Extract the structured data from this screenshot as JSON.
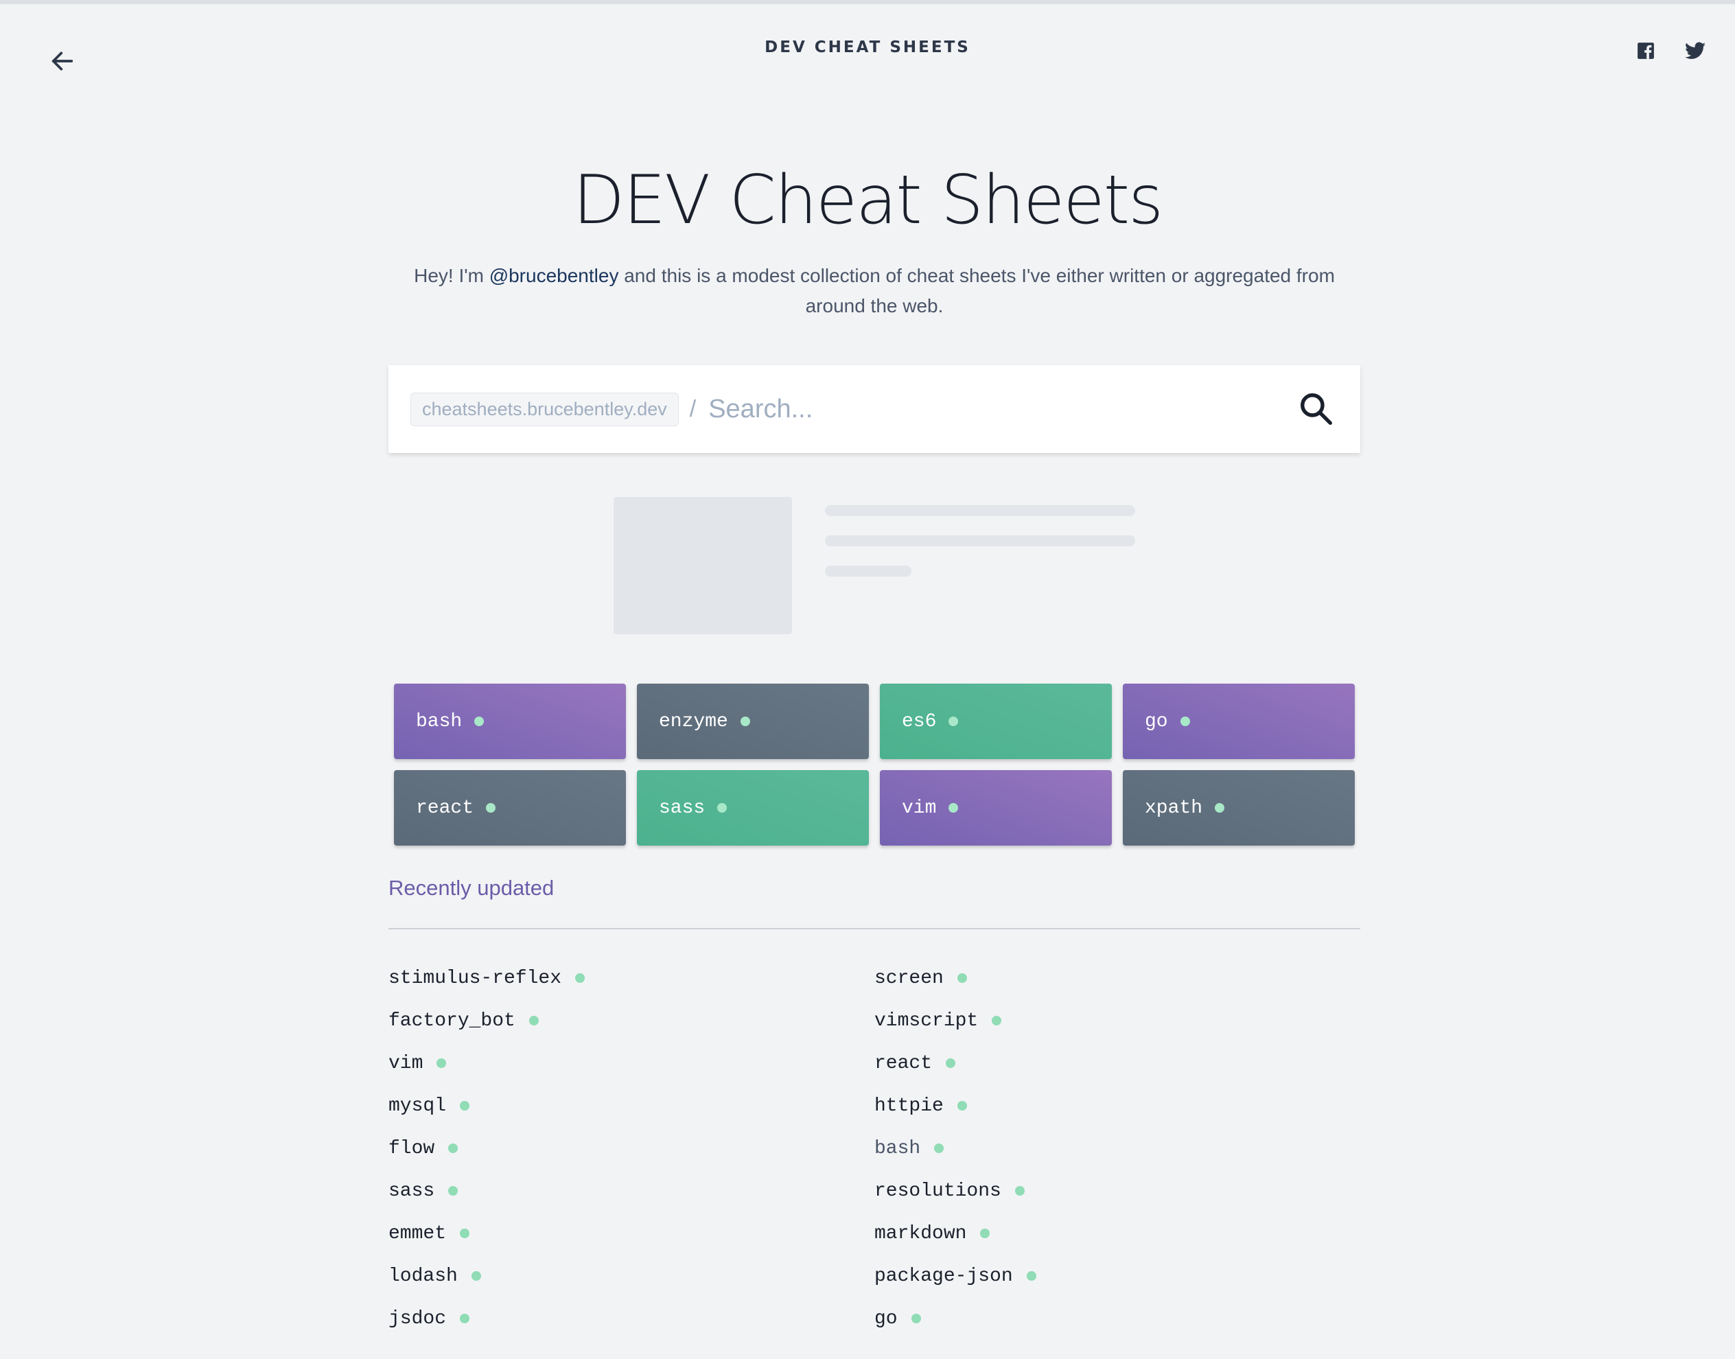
{
  "header": {
    "brand": "DEV CHEAT SHEETS",
    "back_icon": "arrow-left-icon",
    "social_icons": [
      "facebook-icon",
      "twitter-icon"
    ]
  },
  "hero": {
    "title": "DEV Cheat Sheets",
    "intro_before": "Hey! I'm ",
    "intro_link": "@brucebentley",
    "intro_after": " and this is a modest collection of cheat sheets I've either written or aggregated from around the web."
  },
  "search": {
    "domain": "cheatsheets.brucebentley.dev",
    "separator": "/",
    "placeholder": "Search...",
    "value": "",
    "icon": "search-icon"
  },
  "featured": [
    {
      "label": "bash",
      "color": "#7e68b8"
    },
    {
      "label": "enzyme",
      "color": "#5e6d7c"
    },
    {
      "label": "es6",
      "color": "#51b593"
    },
    {
      "label": "go",
      "color": "#7e68b8"
    },
    {
      "label": "react",
      "color": "#5e6d7c"
    },
    {
      "label": "sass",
      "color": "#51b593"
    },
    {
      "label": "vim",
      "color": "#7e68b8"
    },
    {
      "label": "xpath",
      "color": "#5e6d7c"
    }
  ],
  "recent": {
    "heading": "Recently updated",
    "left": [
      "stimulus-reflex",
      "factory_bot",
      "vim",
      "mysql",
      "flow",
      "sass",
      "emmet",
      "lodash",
      "jsdoc"
    ],
    "right": [
      "screen",
      "vimscript",
      "react",
      "httpie",
      "bash",
      "resolutions",
      "markdown",
      "package-json",
      "go"
    ]
  },
  "colors": {
    "accent": "#6b5ca8",
    "dot": "#8fdcb5",
    "background": "#f2f3f5"
  }
}
